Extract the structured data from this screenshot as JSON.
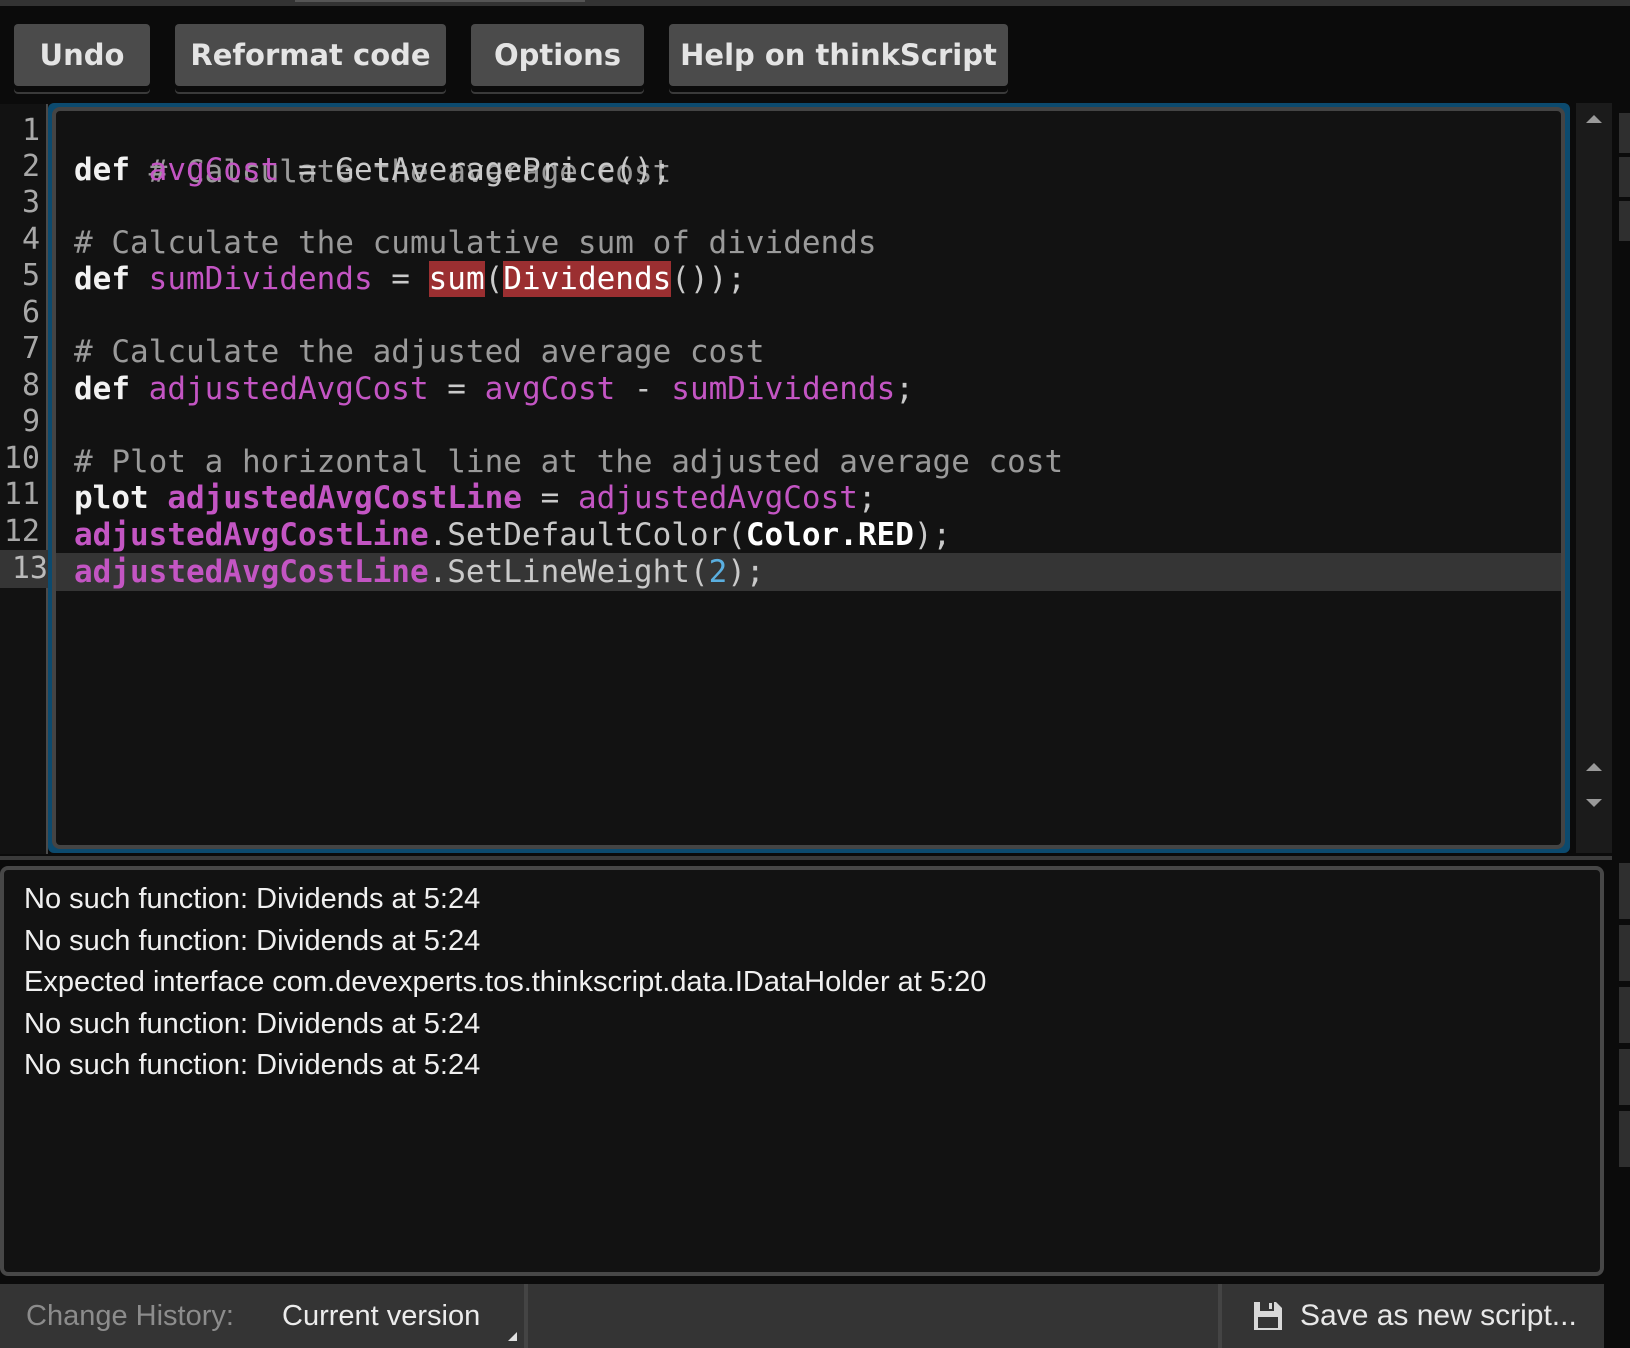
{
  "toolbar": {
    "buttons": [
      {
        "id": "undo",
        "label": "Undo"
      },
      {
        "id": "reformat",
        "label": "Reformat code"
      },
      {
        "id": "options",
        "label": "Options"
      },
      {
        "id": "help",
        "label": "Help on thinkScript"
      }
    ]
  },
  "editor": {
    "current_line": 13,
    "line_numbers": [
      "1",
      "2",
      "3",
      "4",
      "5",
      "6",
      "7",
      "8",
      "9",
      "10",
      "11",
      "12",
      "13"
    ],
    "lines": {
      "l1": {
        "comment": "# Calculate the average cost"
      },
      "l2": {
        "kw": "def",
        "var": "avgCost",
        "op": " = ",
        "fn": "GetAveragePrice();"
      },
      "l3": {},
      "l4": {
        "comment": "# Calculate the cumulative sum of dividends"
      },
      "l5": {
        "kw": "def",
        "var": "sumDividends",
        "op": " = ",
        "err1": "sum",
        "p1": "(",
        "err2": "Dividends",
        "p2": "());"
      },
      "l6": {},
      "l7": {
        "comment": "# Calculate the adjusted average cost"
      },
      "l8": {
        "kw": "def",
        "var": "adjustedAvgCost",
        "op": " = ",
        "var2": "avgCost",
        "op2": " - ",
        "var3": "sumDividends",
        "end": ";"
      },
      "l9": {},
      "l10": {
        "comment": "# Plot a horizontal line at the adjusted average cost"
      },
      "l11": {
        "kw": "plot",
        "var": "adjustedAvgCostLine",
        "op": " = ",
        "var2": "adjustedAvgCost",
        "end": ";"
      },
      "l12": {
        "var": "adjustedAvgCostLine",
        "fn": ".SetDefaultColor(",
        "cst": "Color.RED",
        "end": ");"
      },
      "l13": {
        "var": "adjustedAvgCostLine",
        "fn": ".SetLineWeight(",
        "num": "2",
        "end": ");"
      }
    }
  },
  "console": {
    "messages": [
      "No such function: Dividends at 5:24",
      "No such function: Dividends at 5:24",
      "Expected interface com.devexperts.tos.thinkscript.data.IDataHolder at 5:20",
      "No such function: Dividends at 5:24",
      "No such function: Dividends at 5:24"
    ]
  },
  "status_bar": {
    "change_history_label": "Change History:",
    "change_history_value": "Current version",
    "save_label": "Save as new script...",
    "save_icon": "floppy-disk-icon"
  },
  "colors": {
    "accent_border": "#0c4a6e",
    "error_highlight": "#9b2f31",
    "identifier": "#c355c3",
    "number": "#5aafe0"
  }
}
